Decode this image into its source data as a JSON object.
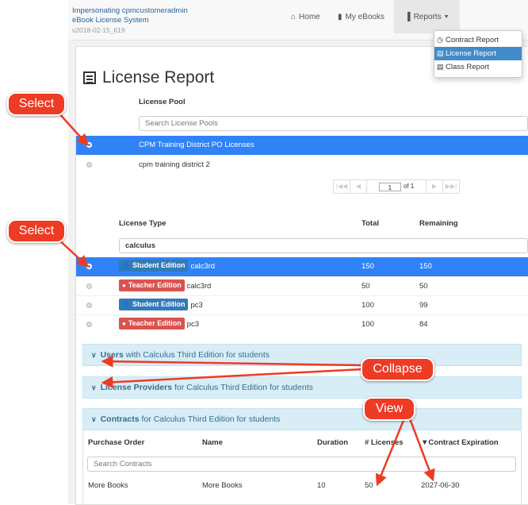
{
  "brand": {
    "impersonating": "Impersonating cpmcustomeradmin",
    "system": "eBook License System",
    "version": "v2018-02-15_619"
  },
  "nav": {
    "home": "Home",
    "ebooks": "My eBooks",
    "reports": "Reports",
    "home_icon": "home-icon",
    "ebooks_icon": "book-icon",
    "reports_icon": "bar-chart-icon"
  },
  "reports_menu": {
    "items": [
      {
        "label": "Contract Report",
        "icon": "clock-icon"
      },
      {
        "label": "License Report",
        "icon": "table-icon",
        "active": true
      },
      {
        "label": "Class Report",
        "icon": "table-icon"
      }
    ]
  },
  "page": {
    "title": "License Report"
  },
  "license_pool": {
    "header": "License Pool",
    "search_placeholder": "Search License Pools",
    "rows": [
      {
        "name": "CPM Training District PO Licenses",
        "selected": true
      },
      {
        "name": "cpm training district 2",
        "selected": false
      }
    ],
    "pager": {
      "page": "1",
      "of": "of 1"
    }
  },
  "license_type": {
    "headers": {
      "type": "License Type",
      "total": "Total",
      "remaining": "Remaining"
    },
    "search_value": "calculus",
    "rows": [
      {
        "badge": "Student Edition",
        "kind": "student",
        "code": "calc3rd",
        "total": "150",
        "remaining": "150",
        "selected": true
      },
      {
        "badge": "Teacher Edition",
        "kind": "teacher",
        "code": "calc3rd",
        "total": "50",
        "remaining": "50",
        "selected": false
      },
      {
        "badge": "Student Edition",
        "kind": "student",
        "code": "pc3",
        "total": "100",
        "remaining": "99",
        "selected": false
      },
      {
        "badge": "Teacher Edition",
        "kind": "teacher",
        "code": "pc3",
        "total": "100",
        "remaining": "84",
        "selected": false
      }
    ]
  },
  "panels": {
    "users": {
      "bold": "Users",
      "rest": " with Calculus Third Edition for students"
    },
    "providers": {
      "bold": "License Providers",
      "rest": " for Calculus Third Edition for students"
    },
    "contracts": {
      "bold": "Contracts",
      "rest": " for Calculus Third Edition for students"
    }
  },
  "contracts": {
    "headers": {
      "po": "Purchase Order",
      "name": "Name",
      "duration": "Duration",
      "licenses": "# Licenses",
      "expiration": "▼Contract Expiration"
    },
    "search_placeholder": "Search Contracts",
    "row": {
      "po": "More Books",
      "name": "More Books",
      "duration": "10",
      "licenses": "50",
      "expiration": "2027-06-30"
    }
  },
  "callouts": {
    "select1": "Select",
    "select2": "Select",
    "collapse": "Collapse",
    "view": "View"
  },
  "colors": {
    "selected_row": "#2f83f6",
    "student_badge": "#337ab7",
    "teacher_badge": "#d9534f",
    "panel_bg": "#d9edf7",
    "panel_text": "#31708f",
    "callout": "#ee3b24"
  }
}
